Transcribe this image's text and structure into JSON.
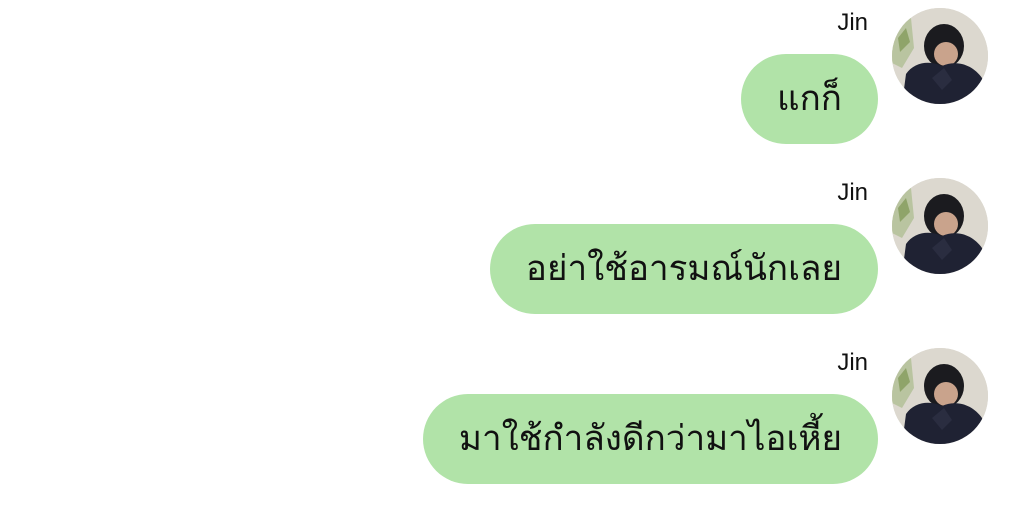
{
  "messages": [
    {
      "sender": "Jin",
      "text": "แกก็",
      "avatar_icon": "profile-photo"
    },
    {
      "sender": "Jin",
      "text": "อย่าใช้อารมณ์นักเลย",
      "avatar_icon": "profile-photo"
    },
    {
      "sender": "Jin",
      "text": "มาใช้กำลังดีกว่ามาไอเหี้ย",
      "avatar_icon": "profile-photo"
    }
  ],
  "colors": {
    "bubble": "#b1e3a8",
    "background": "#ffffff",
    "text": "#111111"
  }
}
